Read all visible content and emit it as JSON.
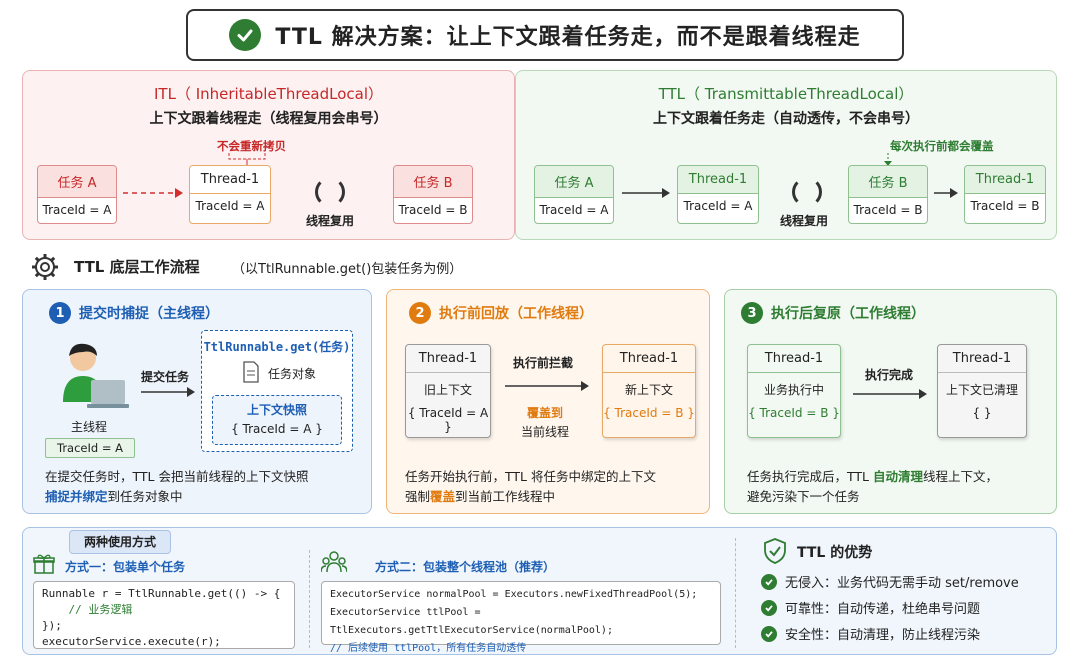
{
  "title": "TTL 解决方案：让上下文跟着任务走，而不是跟着线程走",
  "itl": {
    "title": "ITL（ InheritableThreadLocal）",
    "subtitle": "上下文跟着线程走（线程复用会串号）",
    "task_a": {
      "name": "任务 A",
      "val": "TraceId = A"
    },
    "thread": {
      "name": "Thread-1",
      "val": "TraceId = A"
    },
    "task_b": {
      "name": "任务 B",
      "val": "TraceId = B"
    },
    "note": "不会重新拷贝",
    "reuse": "线程复用"
  },
  "ttl": {
    "title": "TTL（ TransmittableThreadLocal）",
    "subtitle": "上下文跟着任务走（自动透传，不会串号）",
    "task_a": {
      "name": "任务 A",
      "val": "TraceId = A"
    },
    "thread1": {
      "name": "Thread-1",
      "val": "TraceId = A"
    },
    "reuse": "线程复用",
    "task_b": {
      "name": "任务 B",
      "val": "TraceId = B"
    },
    "thread2": {
      "name": "Thread-1",
      "val": "TraceId = B"
    },
    "note": "每次执行前都会覆盖"
  },
  "flow": {
    "title": "TTL 底层工作流程",
    "subtitle": "（以TtlRunnable.get()包装任务为例）"
  },
  "step1": {
    "num": "1",
    "title": "提交时捕捉（主线程）",
    "main_thread": "主线程",
    "traceid": "TraceId = A",
    "action": "提交任务",
    "ttl_title": "TtlRunnable.get(任务)",
    "task_obj": "任务对象",
    "snapshot": "上下文快照",
    "snapshot_val": "{ TraceId = A }",
    "desc1": "在提交任务时，TTL 会把当前线程的上下文快照",
    "desc2_hl": "捕捉并绑定",
    "desc2_rest": "到任务对象中"
  },
  "step2": {
    "num": "2",
    "title": "执行前回放（工作线程）",
    "left_title": "Thread-1",
    "left_l1": "旧上下文",
    "left_l2": "{ TraceId = A }",
    "action": "执行前拦截",
    "action_hl": "覆盖到",
    "action2": "当前线程",
    "right_title": "Thread-1",
    "right_l1": "新上下文",
    "right_l2": "{ TraceId = B }",
    "desc1": "任务开始执行前，TTL 将任务中绑定的上下文",
    "desc2_a": "强制",
    "desc2_hl": "覆盖",
    "desc2_b": "到当前工作线程中"
  },
  "step3": {
    "num": "3",
    "title": "执行后复原（工作线程）",
    "left_title": "Thread-1",
    "left_l1": "业务执行中",
    "left_l2": "{ TraceId = B }",
    "action": "执行完成",
    "right_title": "Thread-1",
    "right_l1": "上下文已清理",
    "right_l2": "{ }",
    "desc1_a": "任务执行完成后，TTL ",
    "desc1_hl": "自动清理",
    "desc1_b": "线程上下文，",
    "desc2": "避免污染下一个任务"
  },
  "usage": {
    "tag": "两种使用方式",
    "way1_title": "方式一：包装单个任务",
    "way1_code": [
      "Runnable r = TtlRunnable.get(() -> {",
      "    // 业务逻辑",
      "});",
      "executorService.execute(r);"
    ],
    "way2_title": "方式二：包装整个线程池（推荐）",
    "way2_code": [
      "ExecutorService normalPool = Executors.newFixedThreadPool(5);",
      "ExecutorService ttlPool = TtlExecutors.getTtlExecutorService(normalPool);"
    ],
    "way2_comment": "// 后续使用 ttlPool，所有任务自动透传",
    "adv_title": "TTL 的优势",
    "advantages": [
      "无侵入：业务代码无需手动 set/remove",
      "可靠性：自动传递，杜绝串号问题",
      "安全性：自动清理，防止线程污染"
    ]
  },
  "colors": {
    "red": "#c62828",
    "green": "#2e7d32",
    "blue": "#1e5fb4",
    "orange": "#e07b10"
  }
}
